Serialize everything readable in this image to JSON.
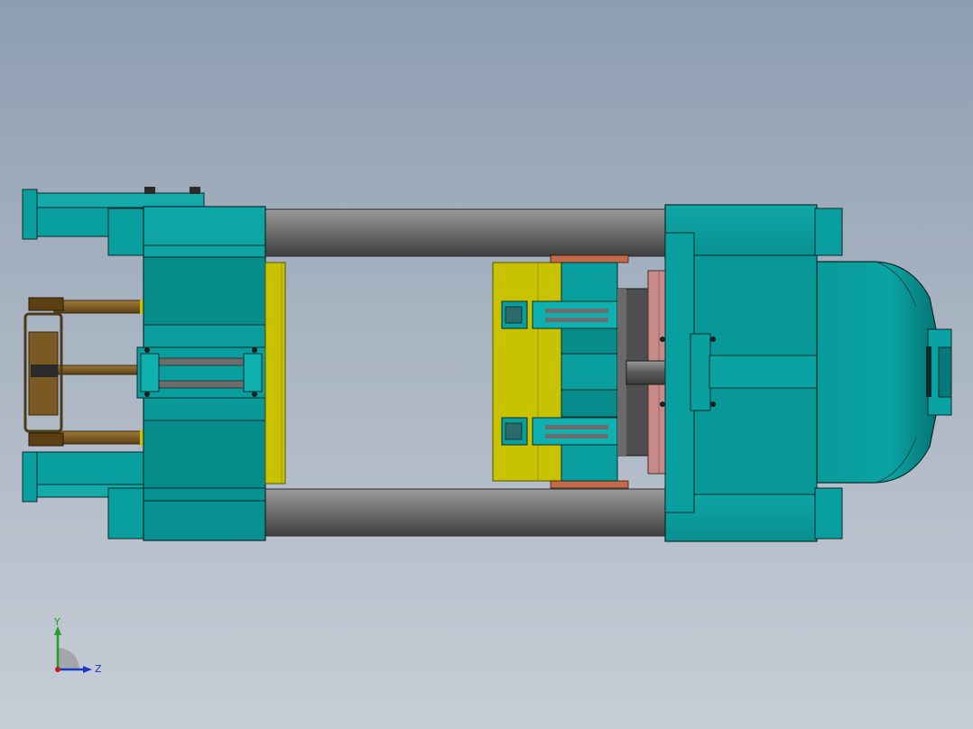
{
  "viewport": {
    "background_top": "#8d9eb1",
    "background_bottom": "#c6cdd6"
  },
  "model": {
    "colors": {
      "teal": "#0a9f9f",
      "teal_dark": "#067a7a",
      "teal_light": "#26b6b6",
      "yellow": "#c9c200",
      "yellow_dark": "#9c9400",
      "gray_bar": "#6c6c6c",
      "gray_dark": "#4a4a4a",
      "brown": "#7a5a22",
      "pink": "#c88a86",
      "edge": "#0d2a2a"
    }
  },
  "triad": {
    "y_label": "Y",
    "z_label": "Z",
    "y_color": "#1fa31f",
    "z_color": "#1b39c8",
    "x_color": "#c81b1b"
  }
}
